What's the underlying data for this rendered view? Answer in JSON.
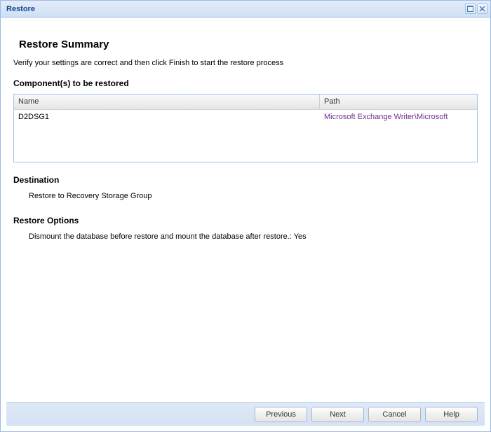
{
  "window": {
    "title": "Restore"
  },
  "summary": {
    "title": "Restore Summary",
    "verify_text": "Verify your settings are correct and then click Finish to start the restore process"
  },
  "components": {
    "heading": "Component(s) to be restored",
    "columns": {
      "name": "Name",
      "path": "Path"
    },
    "rows": [
      {
        "name": "D2DSG1",
        "path": "Microsoft Exchange Writer\\Microsoft"
      }
    ]
  },
  "destination": {
    "heading": "Destination",
    "value": "Restore to Recovery Storage Group"
  },
  "options": {
    "heading": "Restore Options",
    "value": "Dismount the database before restore and mount the database after restore.: Yes"
  },
  "buttons": {
    "previous": "Previous",
    "next": "Next",
    "cancel": "Cancel",
    "help": "Help"
  }
}
